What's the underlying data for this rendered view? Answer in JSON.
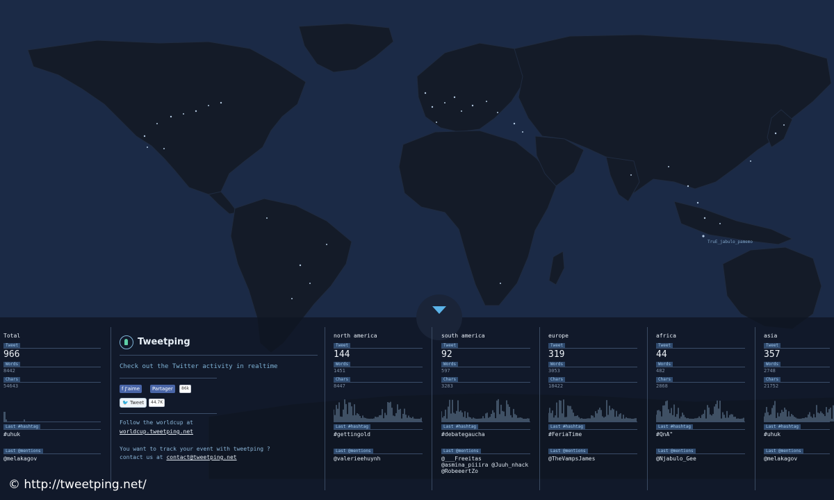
{
  "header": {
    "brand_name": "Tweetping",
    "tagline": "Check out the Twitter activity in realtime"
  },
  "social": {
    "fb_like": "J'aime",
    "fb_share": "Partager",
    "fb_count": "86k",
    "tweet": "Tweet",
    "tweet_count": "44.7K"
  },
  "info": {
    "follow_line": "Follow the worldcup at",
    "follow_link": "worldcup.tweetping.net",
    "track_line": "You want to track your event with tweetping ?",
    "contact_prefix": "contact us at",
    "contact_link": "contact@tweetping.net"
  },
  "labels": {
    "tweet": "Tweet",
    "words": "Words",
    "chars": "Chars",
    "last_hashtag": "Last #hashtag",
    "last_mentions": "Last @mentions"
  },
  "map": {
    "city_label": "TruE_jabulo_pamemo"
  },
  "total": {
    "region": "Total",
    "tweet": "966",
    "words": "8442",
    "chars": "54643",
    "hashtag": "#uhuk",
    "mentions": "@melakagov"
  },
  "regions": [
    {
      "region": "north america",
      "tweet": "144",
      "words": "1451",
      "chars": "8447",
      "hashtag": "#gettingold",
      "mentions": "@valerieehuynh",
      "mentions2": ""
    },
    {
      "region": "south america",
      "tweet": "92",
      "words": "597",
      "chars": "3283",
      "hashtag": "#debategaucha",
      "mentions": "@___Freeitas",
      "mentions2": "@asmina_piiira @Juuh_nhack @RobeeertZo"
    },
    {
      "region": "europe",
      "tweet": "319",
      "words": "3053",
      "chars": "18422",
      "hashtag": "#FeriaTime",
      "mentions": "@TheVampsJames",
      "mentions2": ""
    },
    {
      "region": "africa",
      "tweet": "44",
      "words": "482",
      "chars": "2868",
      "hashtag": "#QnA\"",
      "mentions": "@Njabulo_Gee",
      "mentions2": ""
    },
    {
      "region": "asia",
      "tweet": "357",
      "words": "2748",
      "chars": "21752",
      "hashtag": "#uhuk",
      "mentions": "@melakagov",
      "mentions2": ""
    }
  ],
  "footer": {
    "copyright": "© http://tweetping.net/"
  },
  "colors": {
    "ocean": "#1b2a46",
    "land": "#141b28",
    "accent": "#5bb3e8",
    "tag_bg": "#2f4a6e"
  }
}
